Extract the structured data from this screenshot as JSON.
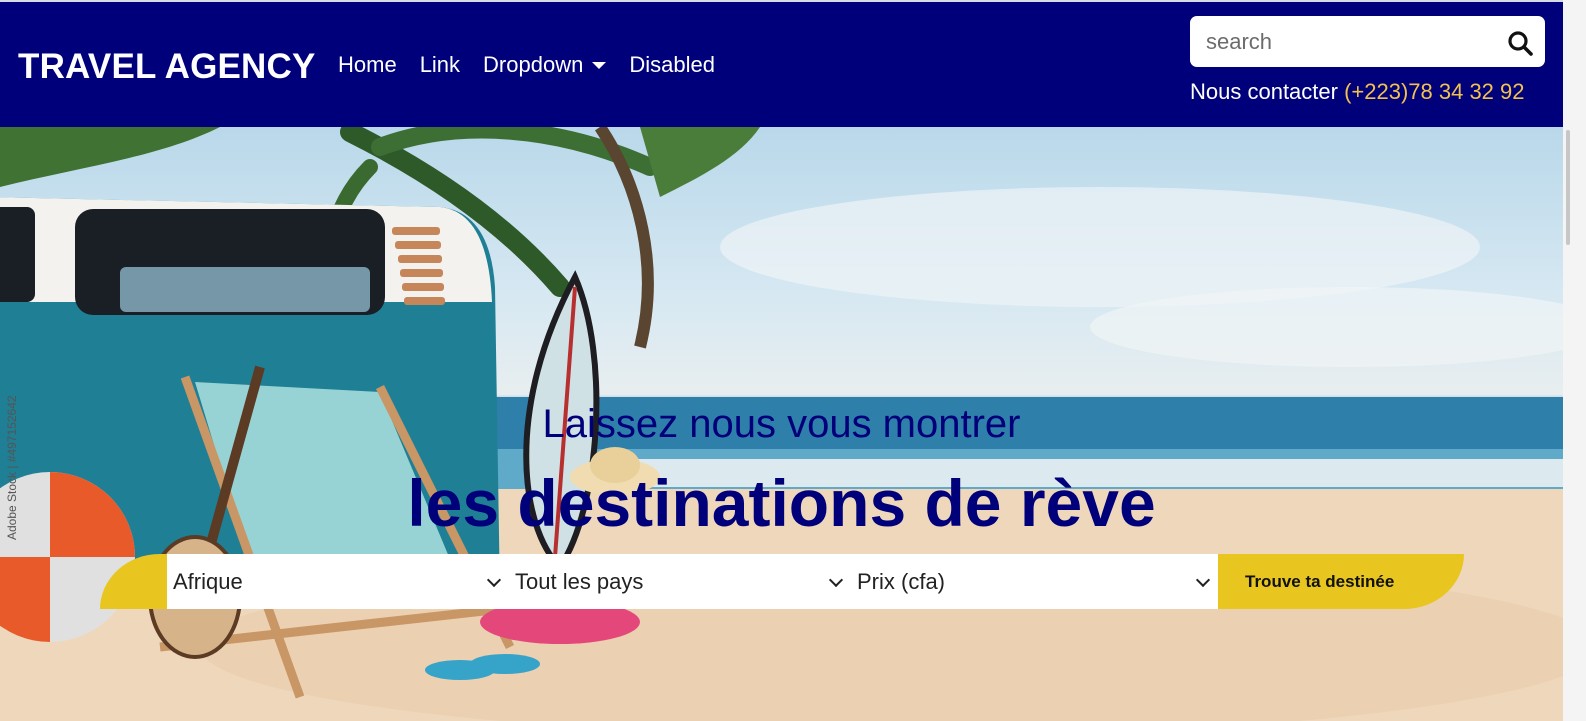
{
  "brand": "TRAVEL AGENCY",
  "nav": {
    "home": "Home",
    "link": "Link",
    "dropdown": "Dropdown",
    "disabled": "Disabled"
  },
  "search": {
    "placeholder": "search"
  },
  "contact": {
    "label": "Nous contacter ",
    "phone": "(+223)78 34 32 92"
  },
  "hero": {
    "headline_small": "Laissez nous vous montrer",
    "headline_big": "les destinations de rève",
    "watermark": "Adobe Stock | #497152642"
  },
  "filters": {
    "continent": "Afrique",
    "country": "Tout les pays",
    "price": "Prix (cfa)",
    "submit_label": "Trouve ta destinée"
  },
  "colors": {
    "navbar": "#00007a",
    "accent": "#e8c61f",
    "phone": "#f2c14e"
  },
  "icons": {
    "search": "search-icon",
    "caret": "caret-down-icon"
  }
}
